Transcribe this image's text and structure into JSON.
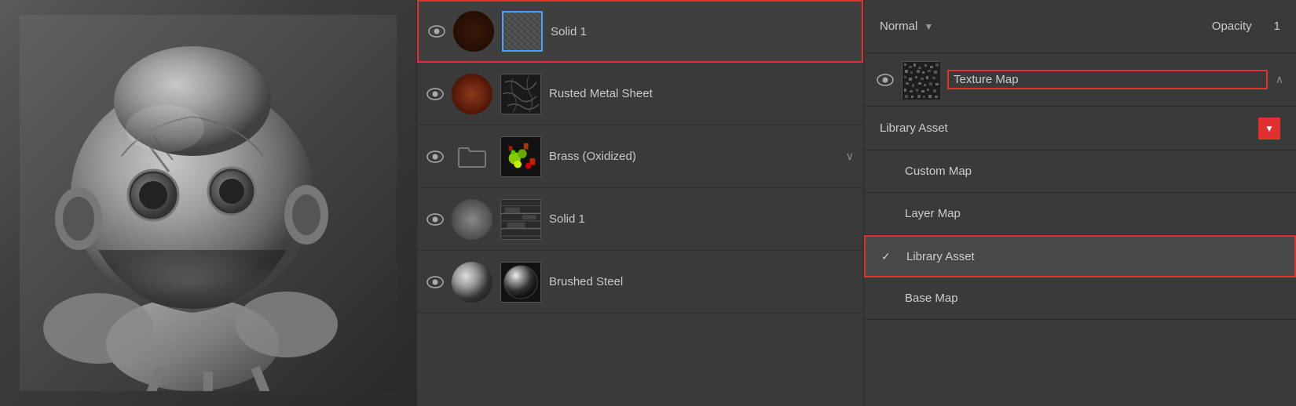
{
  "viewport": {
    "aria_label": "3D Viewport"
  },
  "layer_panel": {
    "layers": [
      {
        "id": "solid1_top",
        "name": "Solid 1",
        "selected": true,
        "has_thumb_circle": true,
        "thumb_type": "dark-brown",
        "thumb_square_type": "noise",
        "thumb_square_selected": true
      },
      {
        "id": "rusted_metal",
        "name": "Rusted Metal Sheet",
        "selected": false,
        "has_thumb_circle": true,
        "thumb_type": "rust",
        "thumb_square_type": "crack"
      },
      {
        "id": "brass_oxidized",
        "name": "Brass (Oxidized)",
        "selected": false,
        "has_thumb_circle": false,
        "thumb_type": "folder",
        "thumb_square_type": "oxidized",
        "has_chevron": true
      },
      {
        "id": "solid1_bottom",
        "name": "Solid 1",
        "selected": false,
        "has_thumb_circle": true,
        "thumb_type": "gray",
        "thumb_square_type": "stone"
      },
      {
        "id": "brushed_steel",
        "name": "Brushed Steel",
        "selected": false,
        "has_thumb_circle": true,
        "thumb_type": "brushed",
        "thumb_square_type": "brushed"
      }
    ]
  },
  "right_panel": {
    "top_bar": {
      "blend_mode_label": "Normal",
      "blend_mode_chevron": "▼",
      "opacity_label": "Opacity",
      "opacity_value": "1"
    },
    "texture_map_row": {
      "label": "Texture Map",
      "expand_icon": "∧"
    },
    "dropdown": {
      "header_label": "Library Asset",
      "header_arrow": "▼",
      "options": [
        {
          "id": "custom_map",
          "label": "Custom Map",
          "active": false,
          "has_check": false
        },
        {
          "id": "layer_map",
          "label": "Layer Map",
          "active": false,
          "has_check": false
        },
        {
          "id": "library_asset",
          "label": "Library Asset",
          "active": true,
          "has_check": true
        },
        {
          "id": "base_map",
          "label": "Base Map",
          "active": false,
          "has_check": false
        }
      ]
    }
  }
}
